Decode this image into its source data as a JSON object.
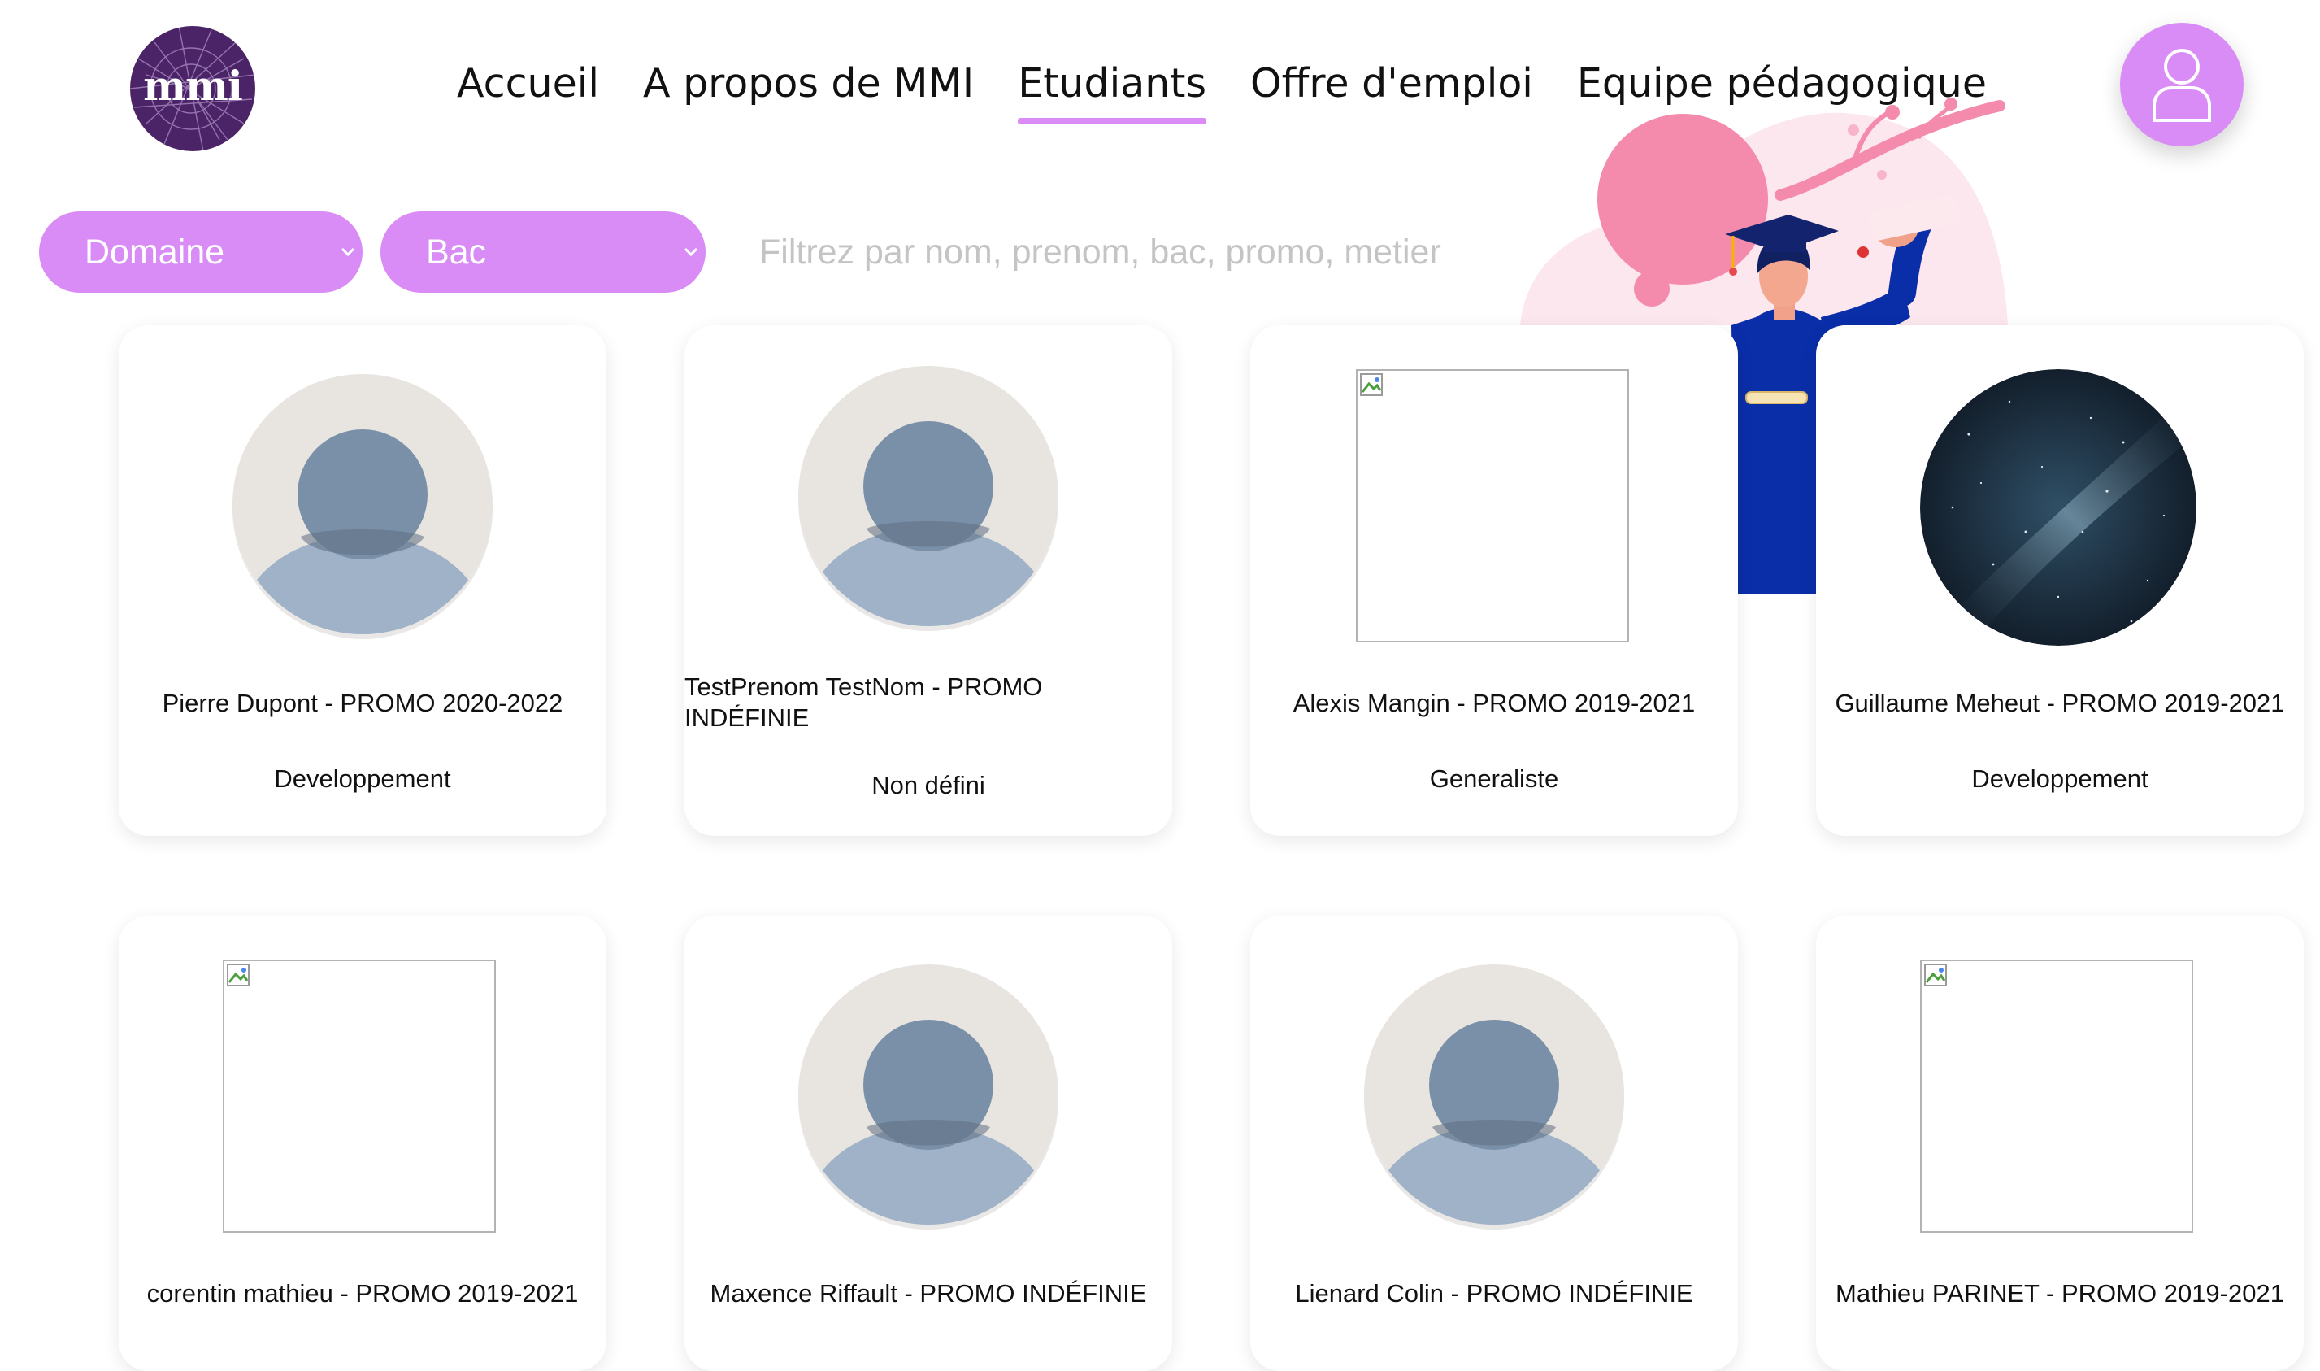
{
  "logo": {
    "text": "mmi"
  },
  "nav": [
    {
      "label": "Accueil",
      "active": false
    },
    {
      "label": "A propos de MMI",
      "active": false
    },
    {
      "label": "Etudiants",
      "active": true
    },
    {
      "label": "Offre d'emploi",
      "active": false
    },
    {
      "label": "Equipe pédagogique",
      "active": false
    }
  ],
  "profile_icon": "user-icon",
  "filters": {
    "domaine_label": "Domaine",
    "bac_label": "Bac",
    "search_placeholder": "Filtrez par nom, prenom, bac, promo, metier",
    "search_value": ""
  },
  "colors": {
    "accent": "#d98cf5",
    "logo_bg": "#4a2466",
    "illustration_pink": "#f48bac",
    "gown_blue": "#0a2ea8"
  },
  "students": [
    {
      "name": "Pierre Dupont - PROMO 2020-2022",
      "domain": "Developpement",
      "avatar": "default"
    },
    {
      "name": "TestPrenom TestNom - PROMO INDÉFINIE",
      "domain": "Non défini",
      "avatar": "default"
    },
    {
      "name": "Alexis Mangin - PROMO 2019-2021",
      "domain": "Generaliste",
      "avatar": "broken"
    },
    {
      "name": "Guillaume Meheut - PROMO 2019-2021",
      "domain": "Developpement",
      "avatar": "photo"
    },
    {
      "name": "corentin mathieu - PROMO 2019-2021",
      "domain": "",
      "avatar": "broken"
    },
    {
      "name": "Maxence Riffault - PROMO INDÉFINIE",
      "domain": "",
      "avatar": "default"
    },
    {
      "name": "Lienard Colin - PROMO INDÉFINIE",
      "domain": "",
      "avatar": "default"
    },
    {
      "name": "Mathieu PARINET - PROMO 2019-2021",
      "domain": "",
      "avatar": "broken"
    }
  ]
}
